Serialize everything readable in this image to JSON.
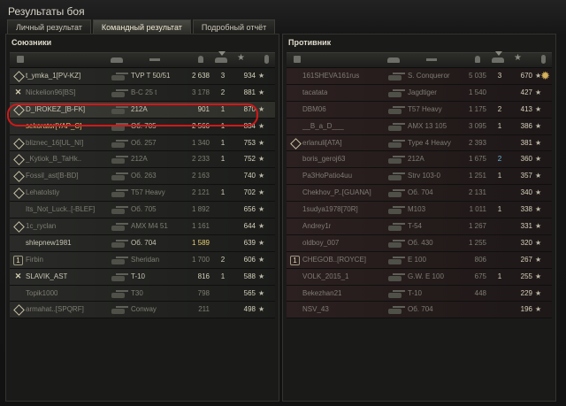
{
  "window": {
    "title": "Результаты боя"
  },
  "tabs": [
    {
      "label": "Личный результат",
      "active": false
    },
    {
      "label": "Командный результат",
      "active": true
    },
    {
      "label": "Подробный отчёт",
      "active": false
    }
  ],
  "allies": {
    "title": "Союзники",
    "rows": [
      {
        "squad": "diamond",
        "name": "t_ymka_1[PV-KZ]",
        "vehicle": "TVP T 50/51",
        "damage": "2 638",
        "kills": "3",
        "xp": "934",
        "dead": false
      },
      {
        "squad": "x",
        "name": "Nickelion96[BS]",
        "vehicle": "B-C 25 t",
        "damage": "3 178",
        "kills": "2",
        "xp": "881",
        "dead": true
      },
      {
        "squad": "diamond",
        "name": "D_IROKEZ_[B-FK]",
        "vehicle": "212A",
        "damage": "901",
        "kills": "1",
        "xp": "870",
        "dead": false,
        "mine": true
      },
      {
        "squad": "",
        "name": "sekorator[YAP_C]",
        "vehicle": "Об. 705",
        "damage": "2 566",
        "kills": "1",
        "xp": "834",
        "dead": false,
        "team": true
      },
      {
        "squad": "diamond",
        "name": "bliznec_16[UL_NI]",
        "vehicle": "Об. 257",
        "damage": "1 340",
        "kills": "1",
        "xp": "753",
        "dead": true
      },
      {
        "squad": "diamond",
        "name": "_Kytiok_B_TaHk..",
        "vehicle": "212A",
        "damage": "2 233",
        "kills": "1",
        "xp": "752",
        "dead": true
      },
      {
        "squad": "diamond",
        "name": "Fossil_ast[B-BD]",
        "vehicle": "Об. 263",
        "damage": "2 163",
        "kills": "",
        "xp": "740",
        "dead": true
      },
      {
        "squad": "diamond",
        "name": "Lehatolstiy",
        "vehicle": "T57 Heavy",
        "damage": "2 121",
        "kills": "1",
        "xp": "702",
        "dead": true
      },
      {
        "squad": "",
        "name": "Its_Not_Luck..[-BLEF]",
        "vehicle": "Об. 705",
        "damage": "1 892",
        "kills": "",
        "xp": "656",
        "dead": true
      },
      {
        "squad": "diamond",
        "name": "1c_ryclan",
        "vehicle": "AMX M4 51",
        "damage": "1 161",
        "kills": "",
        "xp": "644",
        "dead": true
      },
      {
        "squad": "",
        "name": "shlepnew1981",
        "vehicle": "Об. 704",
        "damage": "1 589",
        "kills": "",
        "xp": "639",
        "dead": false,
        "gold": true
      },
      {
        "squad": "num",
        "num": "1",
        "name": "Firbin",
        "vehicle": "Sheridan",
        "damage": "1 700",
        "kills": "2",
        "xp": "606",
        "dead": true
      },
      {
        "squad": "x",
        "name": "SLAVIK_AST",
        "vehicle": "T-10",
        "damage": "816",
        "kills": "1",
        "xp": "588",
        "dead": false
      },
      {
        "squad": "",
        "name": "Topik1000",
        "vehicle": "T30",
        "damage": "798",
        "kills": "",
        "xp": "565",
        "dead": true
      },
      {
        "squad": "diamond",
        "name": "armahat..[SPQRF]",
        "vehicle": "Conway",
        "damage": "211",
        "kills": "",
        "xp": "498",
        "dead": true
      }
    ]
  },
  "enemies": {
    "title": "Противник",
    "rows": [
      {
        "squad": "",
        "name": "161SHEVA161rus",
        "vehicle": "S. Conqueror",
        "damage": "5 035",
        "kills": "3",
        "xp": "670",
        "dead": true,
        "mark": "gear-icon"
      },
      {
        "squad": "",
        "name": "tacatata",
        "vehicle": "Jagdtiger",
        "damage": "1 540",
        "kills": "",
        "xp": "427",
        "dead": true
      },
      {
        "squad": "",
        "name": "DBM06",
        "vehicle": "T57 Heavy",
        "damage": "1 175",
        "kills": "2",
        "xp": "413",
        "dead": true
      },
      {
        "squad": "",
        "name": "__B_a_D___",
        "vehicle": "AMX 13 105",
        "damage": "3 095",
        "kills": "1",
        "xp": "386",
        "dead": true
      },
      {
        "squad": "diamond",
        "name": "erlanuli[ATA]",
        "vehicle": "Type 4 Heavy",
        "damage": "2 393",
        "kills": "",
        "xp": "381",
        "dead": true
      },
      {
        "squad": "",
        "name": "boris_geroj63",
        "vehicle": "212A",
        "damage": "1 675",
        "kills": "2",
        "xp": "360",
        "dead": true,
        "blue": true
      },
      {
        "squad": "",
        "name": "Pa3HoPatio4uu",
        "vehicle": "Strv 103-0",
        "damage": "1 251",
        "kills": "1",
        "xp": "357",
        "dead": true
      },
      {
        "squad": "",
        "name": "Chekhov_P..[GUANA]",
        "vehicle": "Об. 704",
        "damage": "2 131",
        "kills": "",
        "xp": "340",
        "dead": true
      },
      {
        "squad": "",
        "name": "1sudya1978[70R]",
        "vehicle": "M103",
        "damage": "1 011",
        "kills": "1",
        "xp": "338",
        "dead": true
      },
      {
        "squad": "",
        "name": "Andrey1r",
        "vehicle": "T-54",
        "damage": "1 267",
        "kills": "",
        "xp": "331",
        "dead": true
      },
      {
        "squad": "",
        "name": "oldboy_007",
        "vehicle": "Об. 430",
        "damage": "1 255",
        "kills": "",
        "xp": "320",
        "dead": true
      },
      {
        "squad": "num",
        "num": "1",
        "name": "CHEGOB..[ROYCE]",
        "vehicle": "E 100",
        "damage": "806",
        "kills": "",
        "xp": "267",
        "dead": true
      },
      {
        "squad": "",
        "name": "VOLK_2015_1",
        "vehicle": "G.W. E 100",
        "damage": "675",
        "kills": "1",
        "xp": "255",
        "dead": true
      },
      {
        "squad": "",
        "name": "Bekezhan21",
        "vehicle": "T-10",
        "damage": "448",
        "kills": "",
        "xp": "229",
        "dead": true
      },
      {
        "squad": "",
        "name": "NSV_43",
        "vehicle": "Об. 704",
        "damage": "",
        "kills": "",
        "xp": "196",
        "dead": true
      }
    ]
  }
}
